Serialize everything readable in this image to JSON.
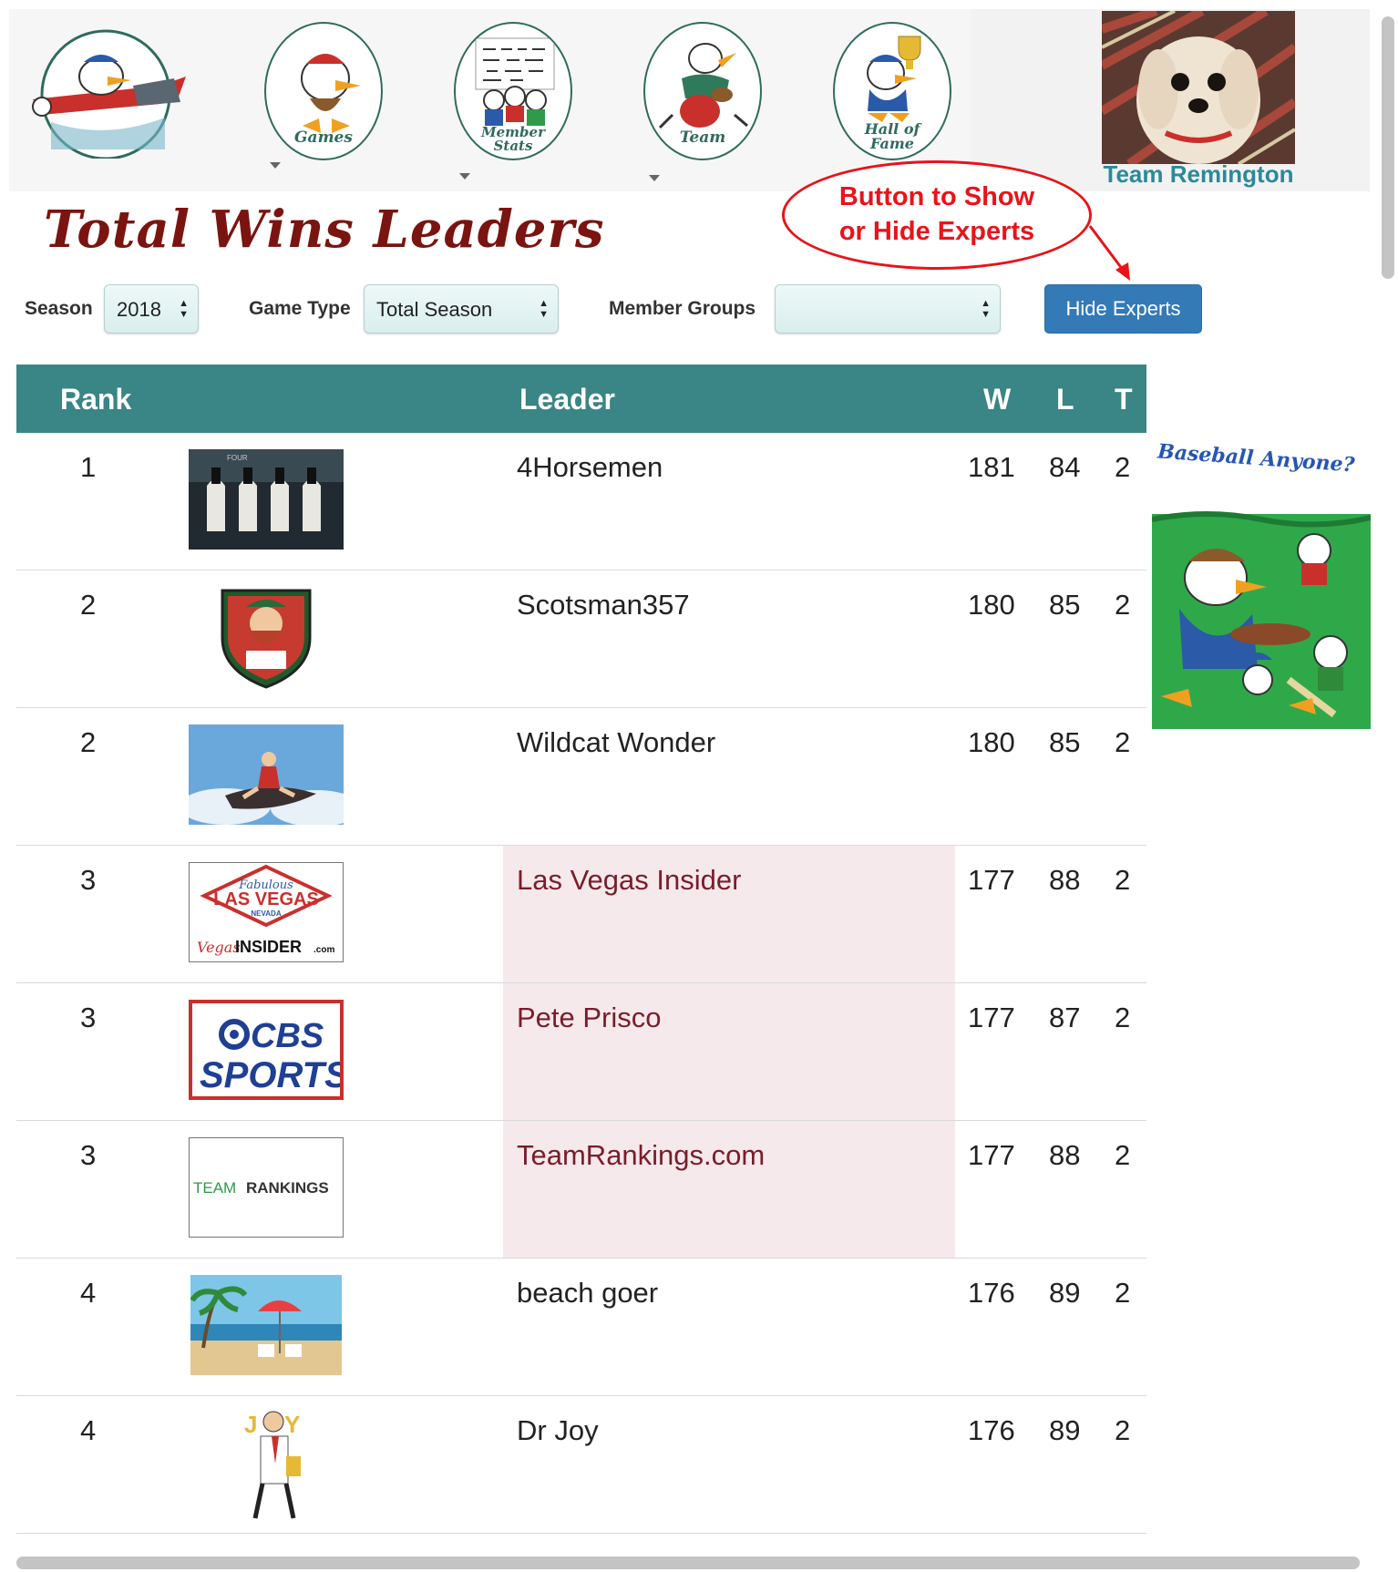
{
  "header": {
    "nav_items": [
      {
        "label": ""
      },
      {
        "label": "Games"
      },
      {
        "label": "Member Stats"
      },
      {
        "label": "Team"
      },
      {
        "label": "Hall of Fame"
      }
    ],
    "team_name": "Team Remington"
  },
  "annotation": {
    "line1": "Button to Show",
    "line2": "or Hide Experts"
  },
  "page_title": "Total Wins Leaders",
  "filters": {
    "season_label": "Season",
    "season_value": "2018",
    "game_type_label": "Game Type",
    "game_type_value": "Total Season",
    "member_groups_label": "Member Groups",
    "member_groups_value": "",
    "hide_experts_label": "Hide Experts"
  },
  "table": {
    "headers": {
      "rank": "Rank",
      "leader": "Leader",
      "w": "W",
      "l": "L",
      "t": "T"
    },
    "rows": [
      {
        "rank": "1",
        "leader": "4Horsemen",
        "w": "181",
        "l": "84",
        "t": "2",
        "expert": false,
        "avatar": "four-horsemen-avatar",
        "avatar_text": "FOUR"
      },
      {
        "rank": "2",
        "leader": "Scotsman357",
        "w": "180",
        "l": "85",
        "t": "2",
        "expert": false,
        "avatar": "scotsman-shield-avatar"
      },
      {
        "rank": "2",
        "leader": "Wildcat Wonder",
        "w": "180",
        "l": "85",
        "t": "2",
        "expert": false,
        "avatar": "pinup-plane-avatar"
      },
      {
        "rank": "3",
        "leader": "Las Vegas Insider",
        "w": "177",
        "l": "88",
        "t": "2",
        "expert": true,
        "avatar": "las-vegas-insider-logo",
        "avatar_text": "Fabulous",
        "avatar_text2": "LAS VEGAS",
        "avatar_text3": "NEVADA",
        "avatar_text4": "Vegas",
        "avatar_text5": "INSIDER",
        "avatar_text6": ".com"
      },
      {
        "rank": "3",
        "leader": "Pete Prisco",
        "w": "177",
        "l": "87",
        "t": "2",
        "expert": true,
        "avatar": "cbs-sports-logo",
        "avatar_text": "CBS",
        "avatar_text2": "SPORTS"
      },
      {
        "rank": "3",
        "leader": "TeamRankings.com",
        "w": "177",
        "l": "88",
        "t": "2",
        "expert": true,
        "avatar": "teamrankings-logo",
        "avatar_text": "TEAM",
        "avatar_text2": "RANKINGS"
      },
      {
        "rank": "4",
        "leader": "beach goer",
        "w": "176",
        "l": "89",
        "t": "2",
        "expert": false,
        "avatar": "beach-painting-avatar"
      },
      {
        "rank": "4",
        "leader": "Dr Joy",
        "w": "176",
        "l": "89",
        "t": "2",
        "expert": false,
        "avatar": "dr-joy-avatar",
        "avatar_text": "J",
        "avatar_text2": "Y"
      }
    ]
  },
  "side_ad": {
    "title": "Baseball Anyone?"
  },
  "colors": {
    "header_teal": "#3a8585",
    "title_red": "#7a1410",
    "annotation_red": "#e8141a",
    "button_blue": "#337ab7",
    "expert_text": "#7a1d2a",
    "expert_bg": "#f5e9ec",
    "team_name": "#2a8a9c"
  }
}
